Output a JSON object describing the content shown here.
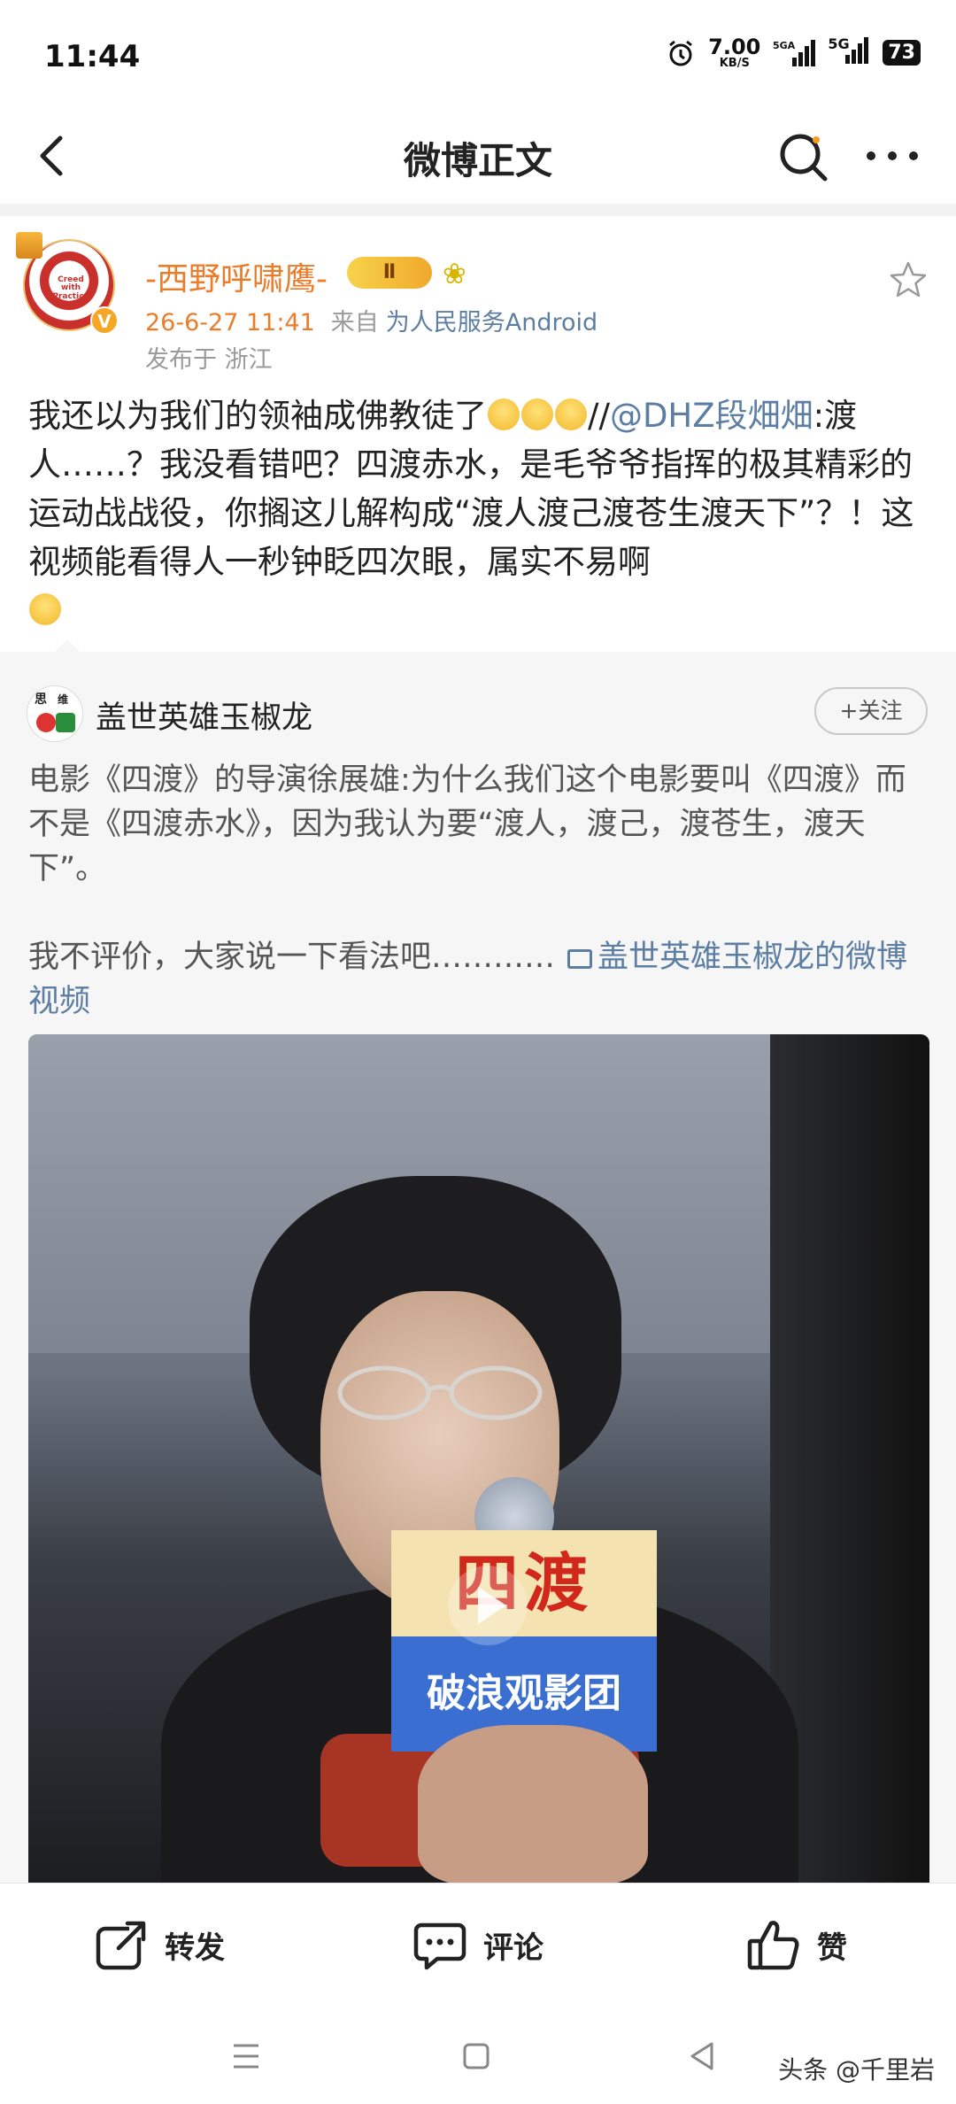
{
  "status_bar": {
    "time": "11:44",
    "speed_value": "7.00",
    "speed_unit": "KB/S",
    "signal1": "⁵⁵⁶ᴬ",
    "signal2": "5G",
    "battery": "73"
  },
  "header": {
    "title": "微博正文"
  },
  "post": {
    "username": "-西野呼啸鹰-",
    "level_badge": "Ⅱ",
    "date": "26-6-27 11:41",
    "from_label": "来自",
    "source": "为人民服务Android",
    "location": "发布于 浙江",
    "text_part1": "我还以为我们的领袖成佛教徒了",
    "text_part2": "//",
    "mention": "@DHZ段畑畑",
    "text_part3": ":渡人……？我没看错吧？四渡赤水，是毛爷爷指挥的极其精彩的运动战战役，你搁这儿解构成“渡人渡己渡苍生渡天下”？！这视频能看得人一秒钟眨四次眼，属实不易啊"
  },
  "quoted": {
    "username": "盖世英雄玉椒龙",
    "follow_label": "+关注",
    "text": "电影《四渡》的导演徐展雄:为什么我们这个电影要叫《四渡》而不是《四渡赤水》，因为我认为要“渡人，渡己，渡苍生，渡天下”。",
    "text2": "我不评价，大家说一下看法吧…………",
    "video_link": "盖世英雄玉椒龙的微博视频",
    "video_sign_top": "四渡",
    "video_sign_bottom": "破浪观影团"
  },
  "actions": {
    "repost": "转发",
    "comment": "评论",
    "like": "赞"
  },
  "watermark": "头条 @千里岩"
}
